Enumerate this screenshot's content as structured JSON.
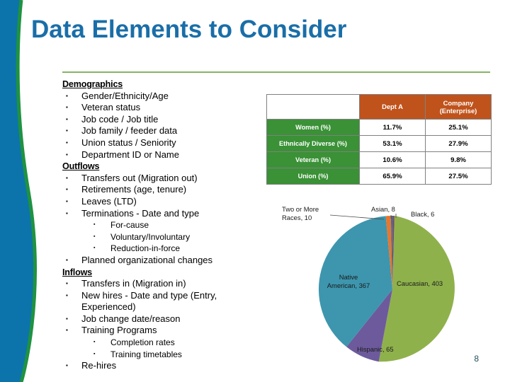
{
  "slide": {
    "title": "Data Elements to Consider",
    "page_number": "8",
    "title_color": "#1a6ea8",
    "rule_color": "#86b463",
    "deco_blue": "#0c74ab",
    "deco_green": "#1f9241"
  },
  "content": {
    "sections": [
      {
        "heading": "Demographics",
        "items": [
          {
            "level": 1,
            "text": "Gender/Ethnicity/Age"
          },
          {
            "level": 1,
            "text": "Veteran status"
          },
          {
            "level": 1,
            "text": "Job code / Job title"
          },
          {
            "level": 1,
            "text": "Job family / feeder data"
          },
          {
            "level": 1,
            "text": "Union status / Seniority"
          },
          {
            "level": 1,
            "text": "Department ID or Name"
          }
        ]
      },
      {
        "heading": "Outflows",
        "items": [
          {
            "level": 1,
            "text": "Transfers out (Migration out)"
          },
          {
            "level": 1,
            "text": "Retirements (age, tenure)"
          },
          {
            "level": 1,
            "text": "Leaves (LTD)"
          },
          {
            "level": 1,
            "text": "Terminations - Date and type"
          },
          {
            "level": 2,
            "text": "For-cause"
          },
          {
            "level": 2,
            "text": "Voluntary/Involuntary"
          },
          {
            "level": 2,
            "text": "Reduction-in-force"
          },
          {
            "level": 1,
            "text": "Planned organizational changes"
          }
        ]
      },
      {
        "heading": "Inflows",
        "items": [
          {
            "level": 1,
            "text": "Transfers in (Migration in)"
          },
          {
            "level": 1,
            "text": "New hires - Date and type (Entry,"
          },
          {
            "level": 0,
            "text": "Experienced)"
          },
          {
            "level": 1,
            "text": "Job change date/reason"
          },
          {
            "level": 1,
            "text": "Training Programs"
          },
          {
            "level": 2,
            "text": "Completion rates"
          },
          {
            "level": 2,
            "text": "Training timetables"
          },
          {
            "level": 1,
            "text": "Re-hires"
          }
        ]
      }
    ]
  },
  "stats_table": {
    "corner_label": "",
    "columns": [
      "Dept A",
      "Company (Enterprise)"
    ],
    "header_bg": "#c0531c",
    "row_label_bg": "#3a9136",
    "rows": [
      {
        "label": "Women (%)",
        "dept_a": "11.7%",
        "company": "25.1%"
      },
      {
        "label": "Ethnically Diverse (%)",
        "dept_a": "53.1%",
        "company": "27.9%"
      },
      {
        "label": "Veteran (%)",
        "dept_a": "10.6%",
        "company": "9.8%"
      },
      {
        "label": "Union (%)",
        "dept_a": "65.9%",
        "company": "27.5%"
      }
    ]
  },
  "chart_data": {
    "type": "pie",
    "title": "",
    "legend_position": "callout-labels",
    "labels": [
      "Caucasian",
      "Hispanic",
      "Native American",
      "Two or More Races",
      "Asian",
      "Black"
    ],
    "values": [
      403,
      65,
      367,
      10,
      8,
      6
    ],
    "colors": [
      "#8fb14c",
      "#6d5a9c",
      "#3d96ae",
      "#e8762c",
      "#3a6ea5",
      "#9a3b3b"
    ],
    "label_texts": {
      "caucasian": "Caucasian, 403",
      "hispanic": "Hispanic, 65",
      "native_american_line1": "Native",
      "native_american_line2": "American, 367",
      "two_or_more_line1": "Two or More",
      "two_or_more_line2": "Races, 10",
      "asian": "Asian, 8",
      "black": "Black, 6"
    }
  }
}
